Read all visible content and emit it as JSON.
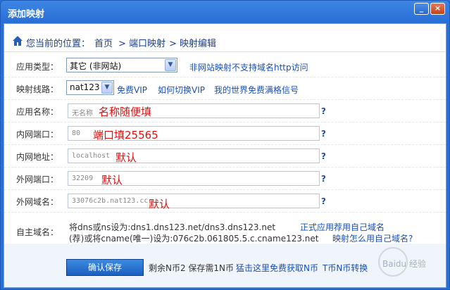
{
  "window": {
    "title": "添加映射",
    "min_label": "_",
    "close_label": "×"
  },
  "breadcrumb": {
    "prefix": "您当前的位置：",
    "items": [
      "首页",
      "> 端口映射",
      "> 映射编辑"
    ]
  },
  "form": {
    "app_type": {
      "label": "应用类型：",
      "value": "其它 (非网站)",
      "note": "非网站映射不支持域名http访问"
    },
    "route": {
      "label": "映射线路：",
      "value": "nat123",
      "links": [
        "免费VIP",
        "如何切换VIP",
        "我的世界免费满格信号"
      ]
    },
    "app_name": {
      "label": "应用名称：",
      "placeholder": "无名称",
      "hint": "名称随便填"
    },
    "lan_port": {
      "label": "内网端口：",
      "placeholder": "80",
      "hint": "端口填25565"
    },
    "lan_addr": {
      "label": "内网地址：",
      "placeholder": "localhost",
      "hint": "默认"
    },
    "wan_port": {
      "label": "外网端口：",
      "placeholder": "32209",
      "hint": "默认"
    },
    "wan_domain": {
      "label": "外网域名：",
      "placeholder": "33076c2b.nat123.cc",
      "hint": "默认"
    },
    "custom_domain": {
      "label": "自主域名：",
      "line1": "将dns或ns设为:dns1.dns123.net/dns3.dns123.net",
      "line1_link": "正式应用荐用自己域名",
      "line2": "(荐)或将cname(唯一)设为:076c2b.061805.5.c.cname123.net",
      "line2_link": "映射怎么用自己域名?"
    },
    "help_mark": "?"
  },
  "footer": {
    "confirm_label": "确认保存",
    "balance": "剩余N币2 保存需1N币",
    "link_free": "猛击这里免费获取N币",
    "link_convert": "T币N币转换"
  },
  "watermark": "Baidu 经验"
}
